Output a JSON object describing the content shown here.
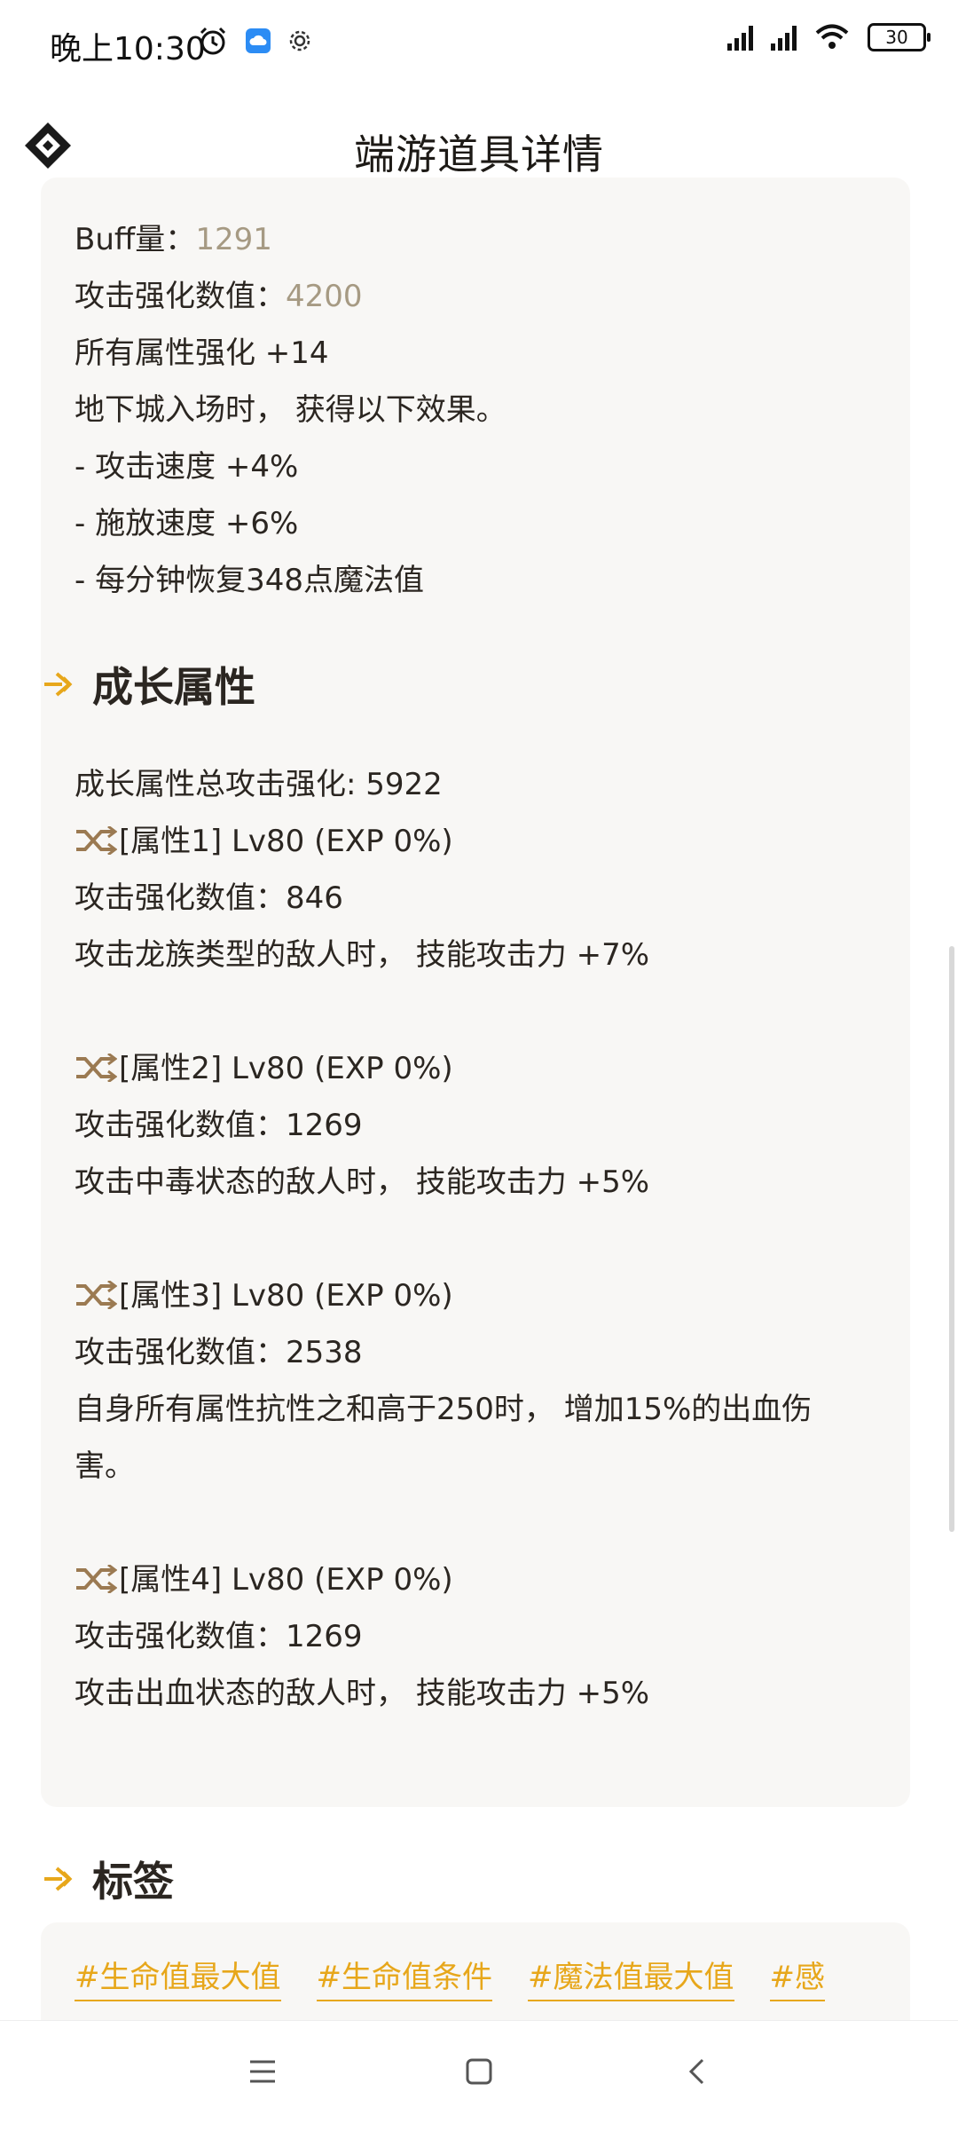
{
  "status": {
    "time": "晚上10:30",
    "battery": "30"
  },
  "header": {
    "title": "端游道具详情"
  },
  "top_card": {
    "lines": [
      {
        "label": "Buff量：",
        "value": "1291"
      },
      {
        "label": "攻击强化数值：",
        "value": "4200"
      },
      {
        "text": "所有属性强化 +14"
      },
      {
        "text": "地下城入场时， 获得以下效果。"
      },
      {
        "text": "- 攻击速度 +4%"
      },
      {
        "text": "- 施放速度 +6%"
      },
      {
        "text": "- 每分钟恢复348点魔法值"
      }
    ]
  },
  "growth": {
    "section_title": "成长属性",
    "total": "成长属性总攻击强化: 5922",
    "attrs": [
      {
        "name": "[属性1] Lv80 (EXP 0%)",
        "value": "攻击强化数值：846",
        "effect": "攻击龙族类型的敌人时， 技能攻击力 +7%"
      },
      {
        "name": "[属性2] Lv80 (EXP 0%)",
        "value": "攻击强化数值：1269",
        "effect": "攻击中毒状态的敌人时， 技能攻击力 +5%"
      },
      {
        "name": "[属性3] Lv80 (EXP 0%)",
        "value": "攻击强化数值：2538",
        "effect": "自身所有属性抗性之和高于250时， 增加15%的出血伤",
        "effect_cont": "害。"
      },
      {
        "name": "[属性4] Lv80 (EXP 0%)",
        "value": "攻击强化数值：1269",
        "effect": "攻击出血状态的敌人时， 技能攻击力 +5%"
      }
    ]
  },
  "tags": {
    "section_title": "标签",
    "items": [
      "#生命值最大值",
      "#生命值条件",
      "#魔法值最大值",
      "#感"
    ]
  },
  "colors": {
    "accent": "#e7a71b",
    "muted_value": "#a69a83",
    "card_bg": "#f8f7f5"
  }
}
